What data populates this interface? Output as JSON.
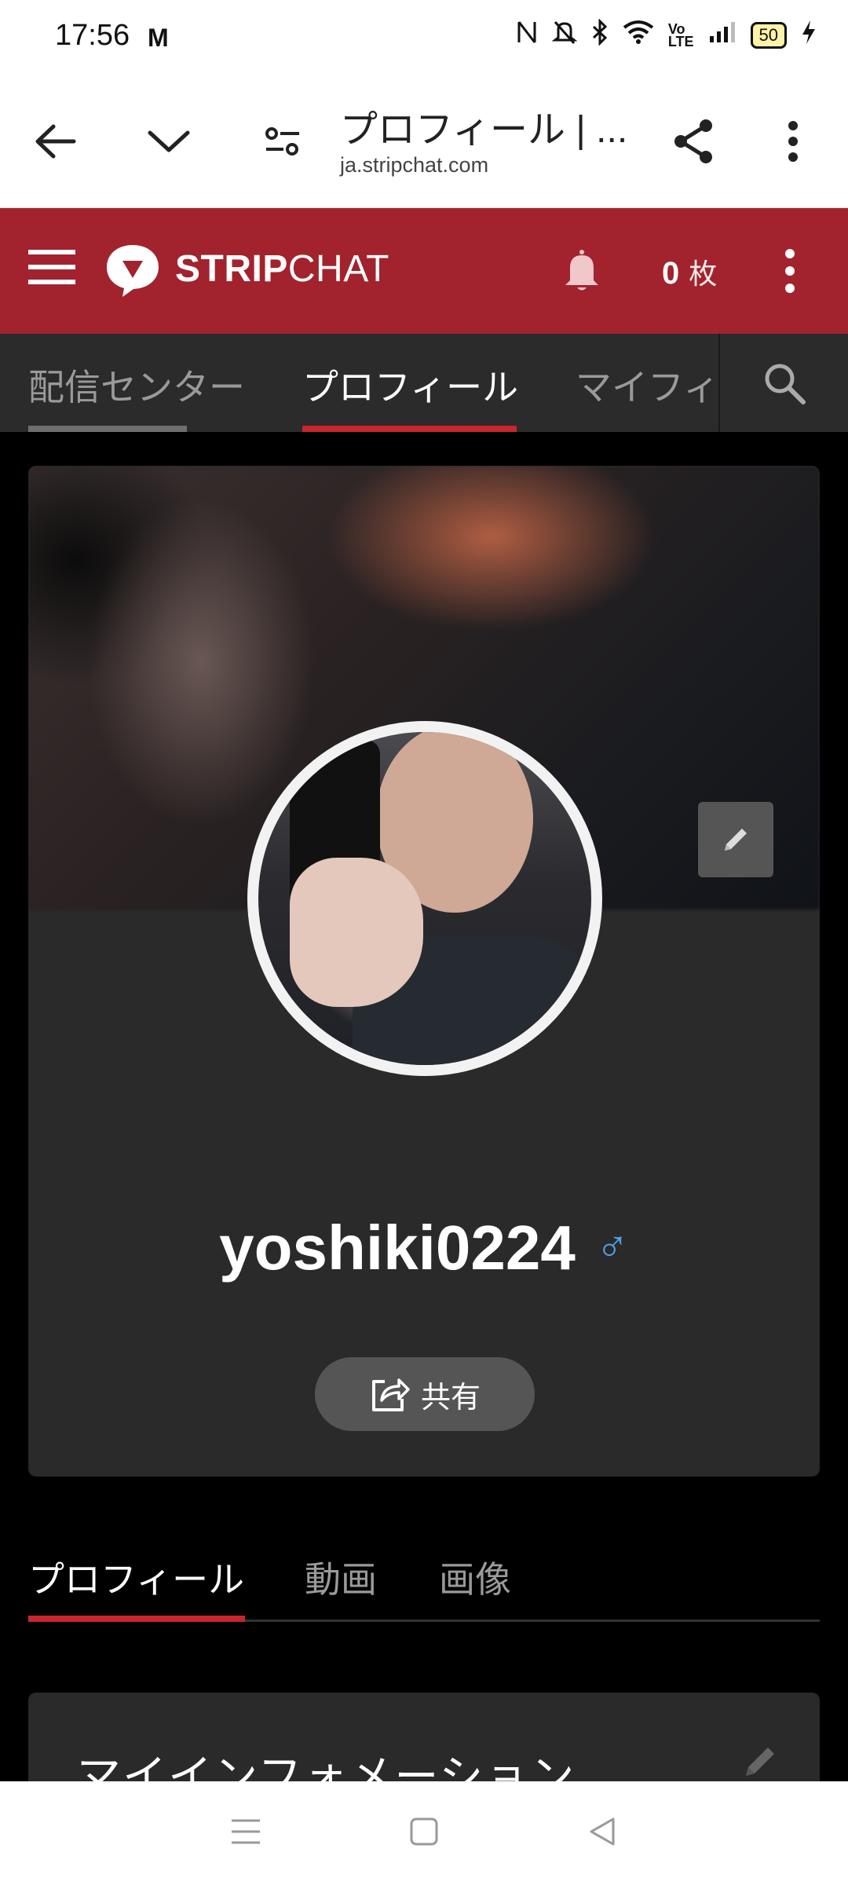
{
  "status_bar": {
    "time": "17:56",
    "gmail_icon": "M",
    "battery": "50"
  },
  "browser": {
    "title": "プロフィール | ...",
    "url": "ja.stripchat.com"
  },
  "site_header": {
    "brand_bold": "STRIP",
    "brand_light": "CHAT",
    "token_count": "0",
    "token_unit": "枚",
    "accent_color": "#a2232d"
  },
  "nav_tabs": [
    {
      "label": "配信センター"
    },
    {
      "label": "プロフィール"
    },
    {
      "label": "マイフィ"
    }
  ],
  "profile": {
    "username": "yoshiki0224",
    "gender_symbol": "♂",
    "share_label": "共有"
  },
  "content_tabs": [
    {
      "label": "プロフィール"
    },
    {
      "label": "動画"
    },
    {
      "label": "画像"
    }
  ],
  "info_card": {
    "title": "マイインフォメーション"
  }
}
